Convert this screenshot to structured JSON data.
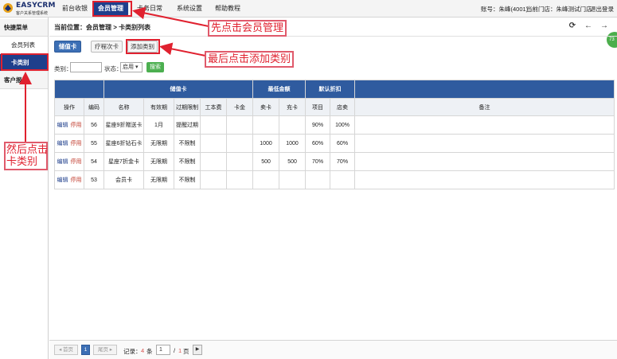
{
  "header": {
    "brand": "EASYCRM",
    "brand_sub": "客户关系管理系统",
    "nav": [
      "前台收银",
      "会员管理",
      "卡务日常",
      "系统设置",
      "帮助教程"
    ],
    "account": "账号：朱峰(4001)",
    "store": "当前门店：朱峰测试门店",
    "logout": "退出登录"
  },
  "sidebar": {
    "title": "快捷菜单",
    "items": [
      "会员列表",
      "卡类别"
    ],
    "section2": "客户报表"
  },
  "main": {
    "breadcrumb": "当前位置：会员管理 > 卡类别列表",
    "tabs": [
      "储值卡",
      "疗程次卡"
    ],
    "add_button": "添加类别",
    "filter": {
      "category_label": "类别：",
      "status_label": "状态：",
      "status_value": "启用 ▾",
      "search_button": "搜索"
    },
    "table": {
      "group_headers": [
        "储值卡",
        "最低金额",
        "默认折扣"
      ],
      "columns": [
        "操作",
        "编码",
        "名称",
        "有效期",
        "过期限制",
        "工本费",
        "卡金",
        "卖卡",
        "充卡",
        "项目",
        "店卖",
        "备注"
      ],
      "action_edit": "编辑",
      "action_stop": "停用",
      "rows": [
        [
          "56",
          "星座9折赠送卡",
          "1月",
          "提醒过期",
          "",
          "",
          "",
          "",
          "90%",
          "100%",
          ""
        ],
        [
          "55",
          "星座6折钻石卡",
          "无限期",
          "不限制",
          "",
          "",
          "1000",
          "1000",
          "60%",
          "60%",
          ""
        ],
        [
          "54",
          "星座7折金卡",
          "无限期",
          "不限制",
          "",
          "",
          "500",
          "500",
          "70%",
          "70%",
          ""
        ],
        [
          "53",
          "会员卡",
          "无限期",
          "不限制",
          "",
          "",
          "",
          "",
          "",
          "",
          ""
        ]
      ]
    },
    "pager": {
      "first": "◂ 首页",
      "current": "1",
      "last": "尾页 ▸",
      "record_label": "记录：",
      "record_count": "4",
      "record_unit": "条",
      "page_input": "1",
      "page_sep": "/",
      "page_total": "1",
      "page_unit": "页",
      "go": "▶"
    },
    "bubble": "73"
  },
  "annotations": {
    "step1": "先点击会员管理",
    "step2_line1": "然后点击",
    "step2_line2": "卡类别",
    "step3": "最后点击添加类别"
  },
  "colors": {
    "nav_active": "#1f3f8c",
    "table_header": "#2f5b9f",
    "annotation": "#e0212f"
  }
}
